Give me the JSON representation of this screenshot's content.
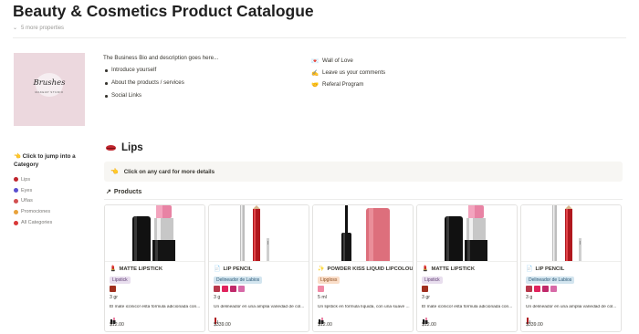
{
  "page": {
    "title": "Beauty & Cosmetics Product Catalogue",
    "more_properties": "5 more properties"
  },
  "logo": {
    "script_text": "Brushes",
    "subtitle": "MAKEUP STUDIO"
  },
  "bio": {
    "description": "The Business Bio and description goes here...",
    "bullets": [
      "Introduce yourself",
      "About the products / services",
      "Social Links"
    ]
  },
  "links": [
    {
      "icon": "love-letter-icon",
      "label": "Wall of Love"
    },
    {
      "icon": "pencil-icon",
      "label": "Leave us your comments"
    },
    {
      "icon": "handshake-icon",
      "label": "Referal Program"
    }
  ],
  "nav": {
    "heading": "Click to jump into a Category",
    "items": [
      {
        "label": "Lips",
        "color": "#c0252d"
      },
      {
        "label": "Eyes",
        "color": "#5a4fcf"
      },
      {
        "label": "Uñas",
        "color": "#d25050"
      },
      {
        "label": "Promociones",
        "color": "#e8a23a"
      },
      {
        "label": "All Categories",
        "color": "#d93838"
      }
    ]
  },
  "section": {
    "heading": "Lips",
    "callout": "Click on any card for more details",
    "products_heading": "Products"
  },
  "colors": {
    "tag_purple": "#e8deee",
    "tag_blue": "#d3e5ef",
    "tag_orange": "#fadec9"
  },
  "cards": [
    {
      "image": "matte-lipstick",
      "name": "MATTE LIPSTICK",
      "tag": "Lipstick",
      "tag_color": "purple",
      "swatches": [
        "#a0301f"
      ],
      "qty": "3 gr",
      "desc": "El mate icónico! esta fórmula adicionada con...",
      "price": "$12.00"
    },
    {
      "image": "lip-pencil",
      "name": "LIP PENCIL",
      "tag": "Delineador de Labios",
      "tag_color": "blue",
      "swatches": [
        "#b8394c",
        "#e0245e",
        "#c02a6b",
        "#d76aa8"
      ],
      "qty": "3 g",
      "desc": "Un delineador en una amplia variedad de col...",
      "price": "$339.00"
    },
    {
      "image": "liquid-lipcolour",
      "name": "POWDER KISS LIQUID LIPCOLOUR",
      "tag": "Lipgloss",
      "tag_color": "orange",
      "swatches": [
        "#f08aa6"
      ],
      "qty": "5 ml",
      "desc": "Un lipstick en fórmula líquida, con una suave ...",
      "price": "$12.00"
    },
    {
      "image": "matte-lipstick",
      "name": "MATTE LIPSTICK",
      "tag": "Lipstick",
      "tag_color": "purple",
      "swatches": [
        "#a0301f"
      ],
      "qty": "3 gr",
      "desc": "El mate icónico! esta fórmula adicionada con...",
      "price": "$12.00"
    },
    {
      "image": "lip-pencil",
      "name": "LIP PENCIL",
      "tag": "Delineador de Labios",
      "tag_color": "blue",
      "swatches": [
        "#b8394c",
        "#e0245e",
        "#c02a6b",
        "#d76aa8"
      ],
      "qty": "3 g",
      "desc": "Un delineador en una amplia variedad de col...",
      "price": "$339.00"
    }
  ]
}
